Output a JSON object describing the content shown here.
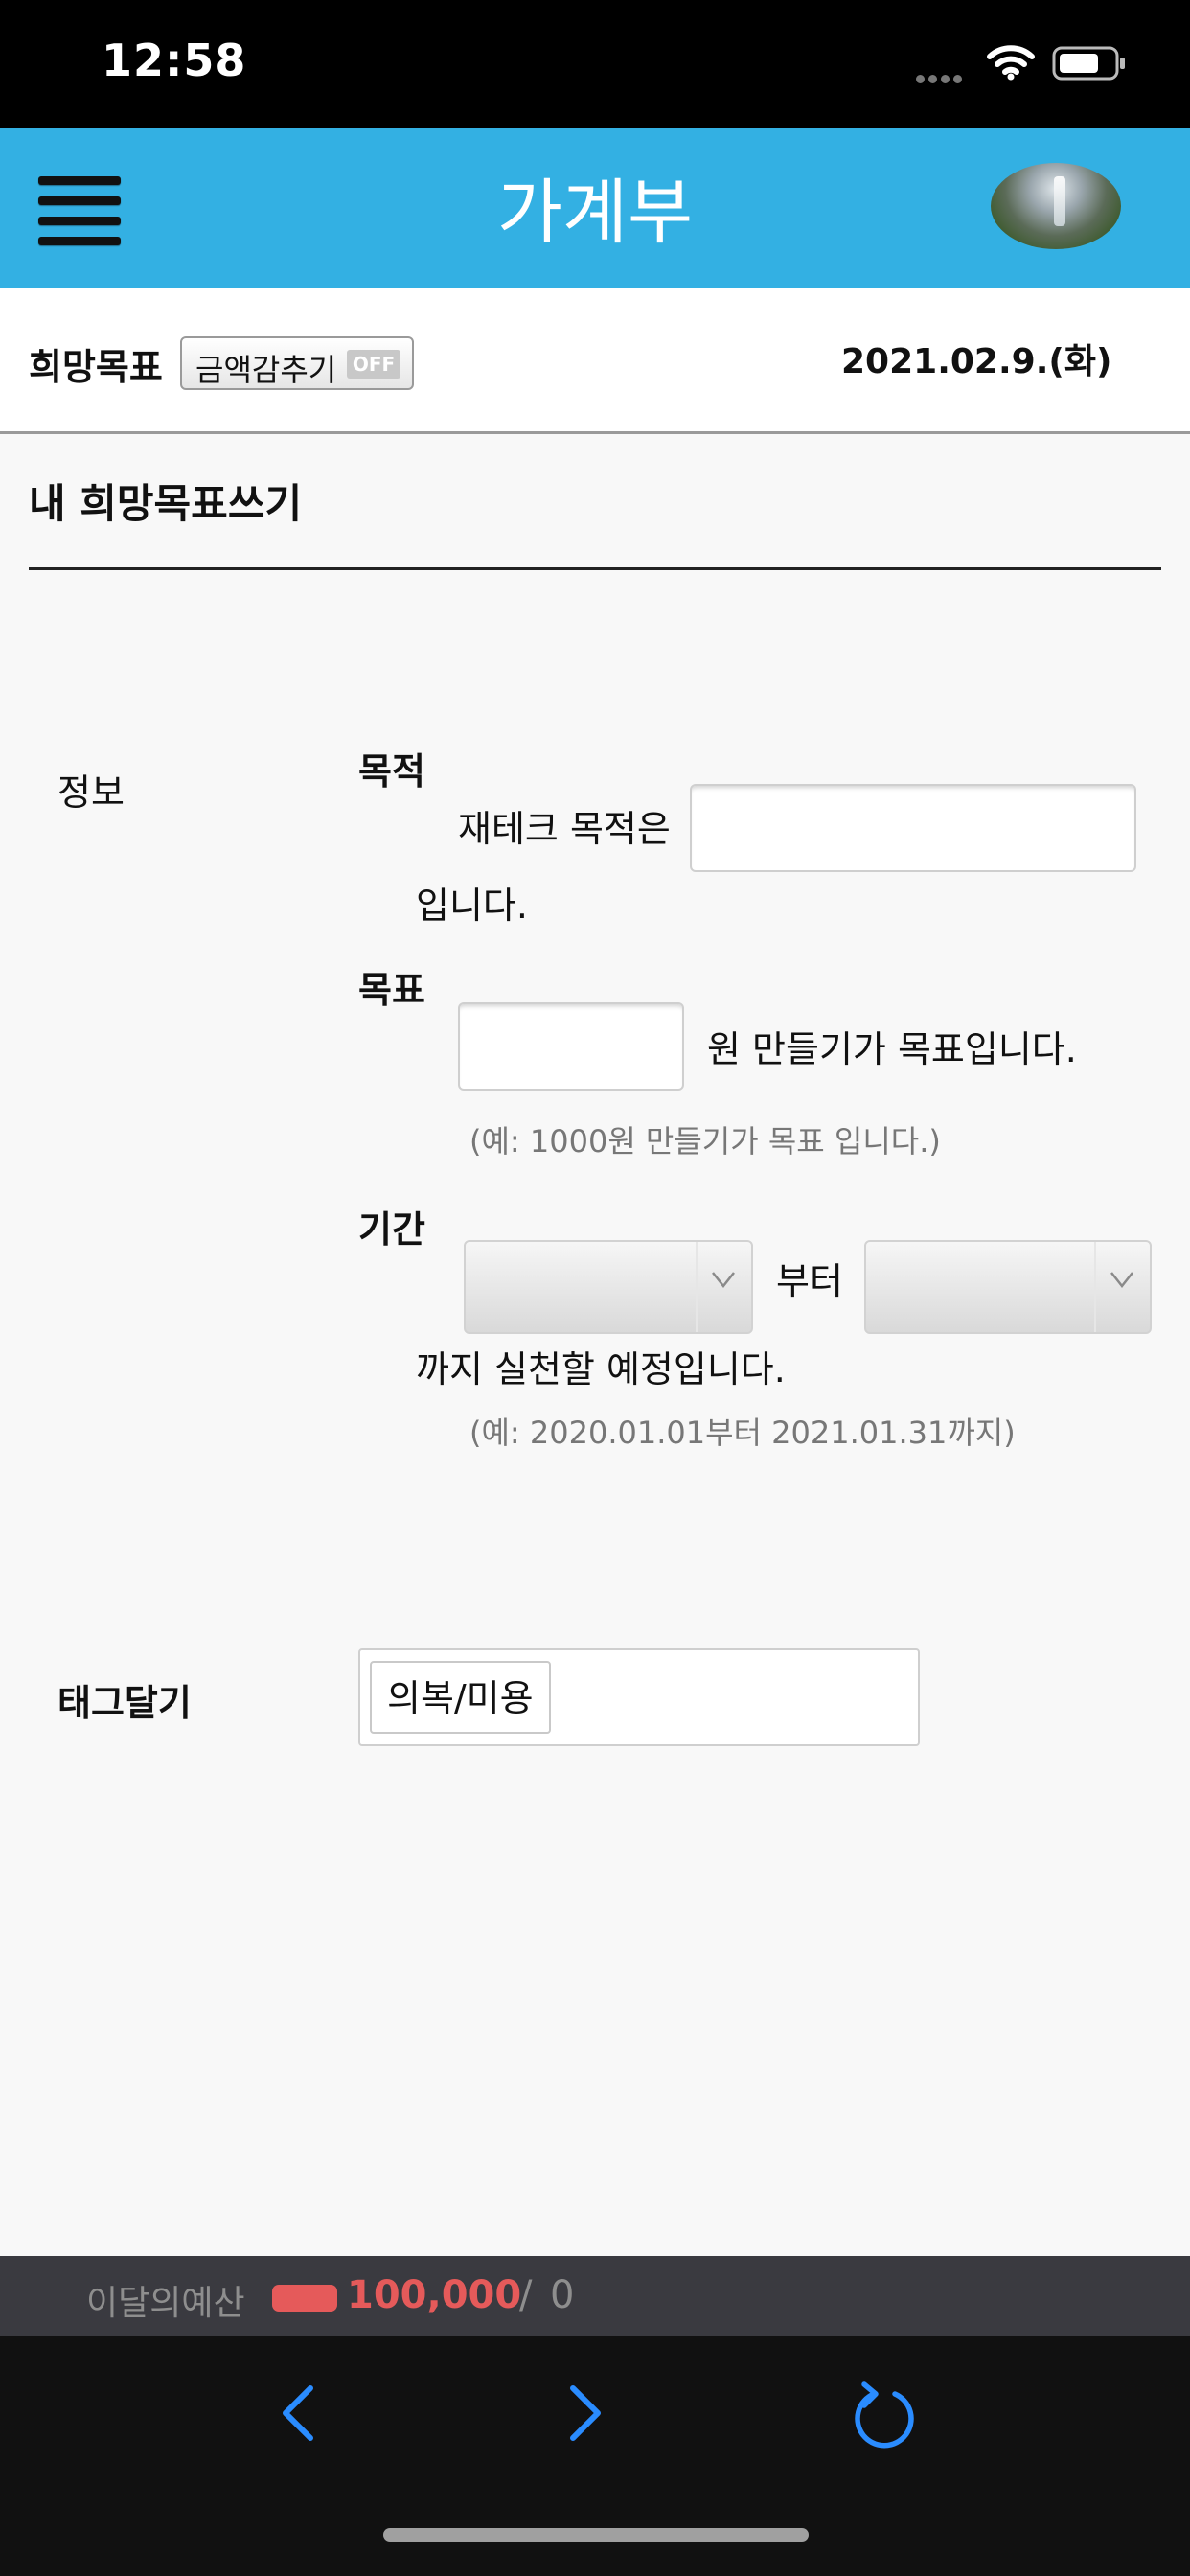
{
  "status_bar": {
    "time": "12:58"
  },
  "header": {
    "title": "가계부",
    "menu_icon": "hamburger-icon",
    "avatar_icon": "waterfall-avatar"
  },
  "info_row": {
    "label": "희망목표",
    "hide_amount": {
      "label": "금액감추기",
      "state": "OFF"
    },
    "date": "2021.02.9.(화)"
  },
  "section": {
    "title": "내 희망목표쓰기"
  },
  "form": {
    "info_label": "정보",
    "purpose": {
      "label": "목적",
      "prefix": "재테크 목적은",
      "value": "",
      "suffix": "입니다."
    },
    "goal": {
      "label": "목표",
      "value": "",
      "suffix": "원 만들기가 목표입니다.",
      "hint": "(예: 1000원 만들기가 목표 입니다.)"
    },
    "period": {
      "label": "기간",
      "start": "",
      "from_text": "부터",
      "end": "",
      "suffix": "까지 실천할 예정입니다.",
      "hint": "(예: 2020.01.01부터 2021.01.31까지)"
    },
    "tag": {
      "label": "태그달기",
      "selected": "의복/미용"
    }
  },
  "budget": {
    "label": "이달의예산",
    "amount": "100,000",
    "separator": "/",
    "spent": "0",
    "accent_color": "#e55a5a"
  },
  "toolbar": {
    "back_icon": "chevron-left-icon",
    "forward_icon": "chevron-right-icon",
    "reload_icon": "reload-icon",
    "accent_color": "#2a8cff"
  },
  "colors": {
    "header_bg": "#33b0e3",
    "toolbar_bg": "#111111",
    "budget_bg": "#3a3a40"
  }
}
